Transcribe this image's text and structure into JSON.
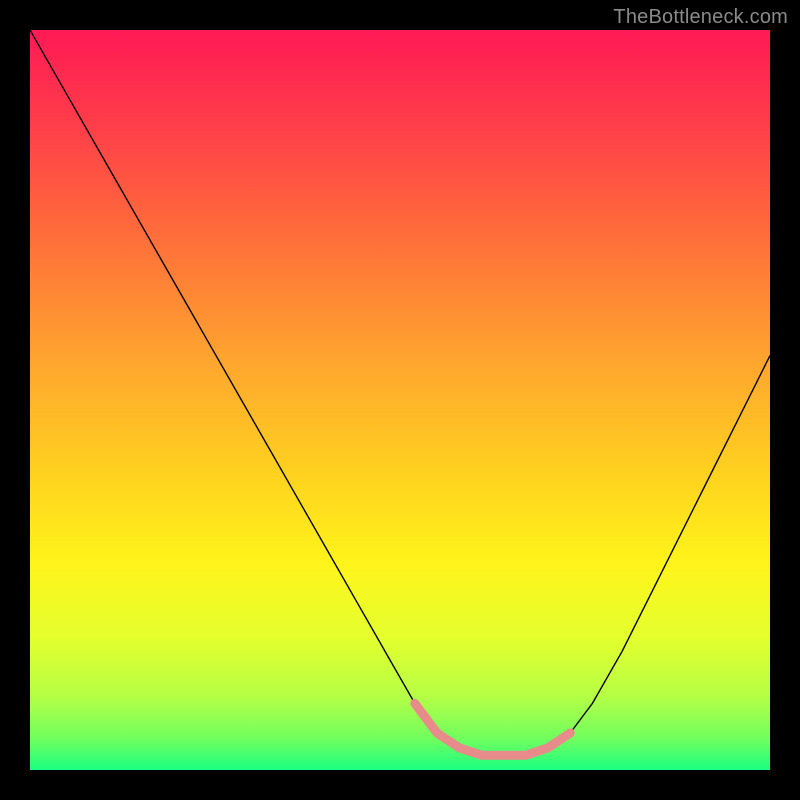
{
  "watermark": "TheBottleneck.com",
  "chart_data": {
    "type": "line",
    "title": "",
    "xlabel": "",
    "ylabel": "",
    "xlim": [
      0,
      100
    ],
    "ylim": [
      0,
      100
    ],
    "grid": false,
    "legend": false,
    "background_gradient": {
      "stops": [
        {
          "offset": 0.0,
          "color": "#ff1a55"
        },
        {
          "offset": 0.12,
          "color": "#ff3b4a"
        },
        {
          "offset": 0.28,
          "color": "#ff6e3a"
        },
        {
          "offset": 0.45,
          "color": "#ffa62e"
        },
        {
          "offset": 0.6,
          "color": "#ffd21f"
        },
        {
          "offset": 0.72,
          "color": "#fff41a"
        },
        {
          "offset": 0.82,
          "color": "#e4ff2d"
        },
        {
          "offset": 0.9,
          "color": "#b6ff45"
        },
        {
          "offset": 0.96,
          "color": "#6dff60"
        },
        {
          "offset": 1.0,
          "color": "#1aff82"
        }
      ]
    },
    "series": [
      {
        "name": "bottleneck-curve",
        "stroke": "#000000",
        "stroke_width": 1.4,
        "x": [
          0,
          4,
          8,
          12,
          16,
          20,
          24,
          28,
          32,
          36,
          40,
          44,
          48,
          52,
          55,
          58,
          61,
          64,
          67,
          70,
          73,
          76,
          80,
          84,
          88,
          92,
          96,
          100
        ],
        "y": [
          100,
          93,
          86,
          79,
          72,
          65,
          58,
          51,
          44,
          37,
          30,
          23,
          16,
          9,
          5,
          3,
          2,
          2,
          2,
          3,
          5,
          9,
          16,
          24,
          32,
          40,
          48,
          56
        ]
      },
      {
        "name": "highlight-band",
        "stroke": "#e88b8b",
        "stroke_width": 9,
        "linecap": "round",
        "x": [
          52,
          55,
          58,
          61,
          64,
          67,
          70,
          73
        ],
        "y": [
          9,
          5,
          3,
          2,
          2,
          2,
          3,
          5
        ]
      }
    ]
  }
}
